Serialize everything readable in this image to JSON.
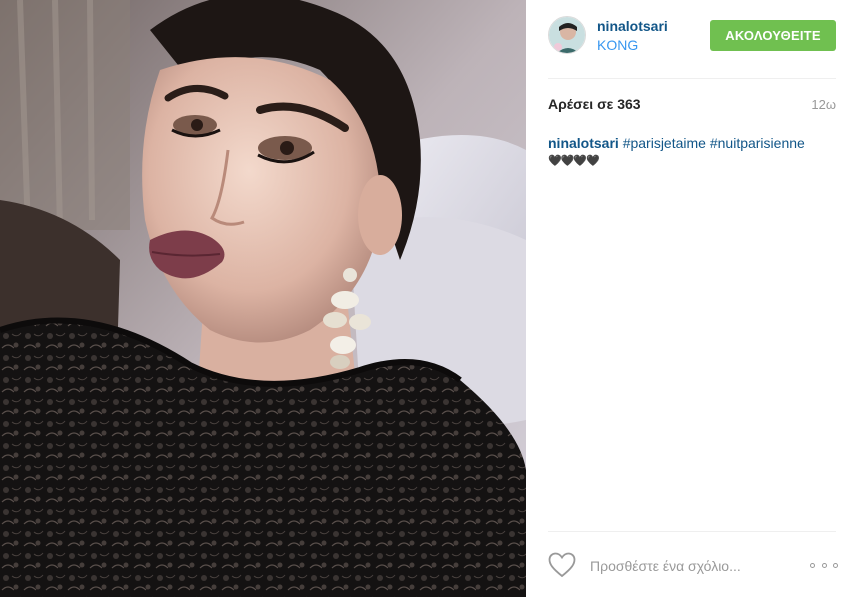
{
  "post": {
    "image_alt": "selfie photo",
    "username": "ninalotsari",
    "location": "KONG",
    "follow_label": "ΑΚΟΛΟΥΘΕΙΤΕ",
    "likes_text": "Αρέσει σε 363",
    "time_text": "12ω",
    "caption": {
      "username": "ninalotsari",
      "hashtags": [
        "#parisjetaime",
        "#nuitparisienne"
      ],
      "emoji": "🖤🖤🖤🖤"
    },
    "comment_placeholder": "Προσθέστε ένα σχόλιο...",
    "icons": {
      "like": "heart-outline-icon",
      "more": "more-options-icon"
    },
    "colors": {
      "follow_button": "#70c050",
      "link": "#125688",
      "location": "#3897f0",
      "muted": "#999999"
    }
  }
}
